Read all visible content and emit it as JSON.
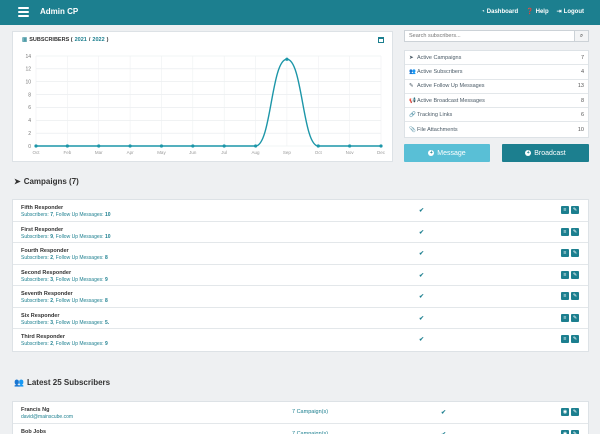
{
  "header": {
    "title": "Admin CP",
    "nav": [
      {
        "icon": "dashboard-icon",
        "label": "Dashboard"
      },
      {
        "icon": "help-icon",
        "label": "Help"
      },
      {
        "icon": "logout-icon",
        "label": "Logout"
      }
    ]
  },
  "chart_panel": {
    "title_prefix": "SUBSCRIBERS (",
    "year_a": "2021",
    "sep": " / ",
    "year_b": "2022",
    "title_suffix": ")"
  },
  "chart_data": {
    "type": "line",
    "title": "SUBSCRIBERS (2021 / 2022)",
    "categories": [
      "Oct",
      "Feb",
      "Mar",
      "Apr",
      "May",
      "Jun",
      "Jul",
      "Aug",
      "Sep",
      "Oct",
      "Nov",
      "Dec"
    ],
    "ylim": [
      0,
      14
    ],
    "yticks": [
      0,
      2,
      4,
      6,
      8,
      10,
      12,
      14
    ],
    "grid": true,
    "series": [
      {
        "values": [
          0,
          0,
          0,
          0,
          0,
          0,
          0,
          0,
          13.5,
          0,
          0,
          0
        ],
        "color": "#1c96a8"
      }
    ]
  },
  "search": {
    "placeholder": "Search subscribers..."
  },
  "stats": [
    {
      "icon": "send-icon",
      "label": "Active Campaigns",
      "value": "7"
    },
    {
      "icon": "users-icon",
      "label": "Active Subscribers",
      "value": "4"
    },
    {
      "icon": "edit-icon",
      "label": "Active Follow Up Messages",
      "value": "13"
    },
    {
      "icon": "megaphone-icon",
      "label": "Active Broadcast Messages",
      "value": "8"
    },
    {
      "icon": "link-icon",
      "label": "Tracking Links",
      "value": "6"
    },
    {
      "icon": "paperclip-icon",
      "label": "File Attachments",
      "value": "10"
    }
  ],
  "buttons": {
    "message": "Message",
    "broadcast": "Broadcast"
  },
  "campaigns": {
    "title": "Campaigns (7)",
    "subscribers_label": "Subscribers: ",
    "followup_label": ", Follow Up Messages: ",
    "items": [
      {
        "name": "Fifth Responder",
        "subscribers": "7",
        "followups": "10"
      },
      {
        "name": "First Responder",
        "subscribers": "9",
        "followups": "10"
      },
      {
        "name": "Fourth Responder",
        "subscribers": "2",
        "followups": "8"
      },
      {
        "name": "Second Responder",
        "subscribers": "3",
        "followups": "9"
      },
      {
        "name": "Seventh Responder",
        "subscribers": "2",
        "followups": "8"
      },
      {
        "name": "Six Responder",
        "subscribers": "3",
        "followups": "5."
      },
      {
        "name": "Third Responder",
        "subscribers": "2",
        "followups": "9"
      }
    ]
  },
  "subscribers": {
    "title": "Latest 25 Subscribers",
    "items": [
      {
        "name": "Francis Ng",
        "email": "david@mainscube.com",
        "campaigns": "7 Campaign(s)"
      },
      {
        "name": "Bob Jobs",
        "email": "",
        "campaigns": "7 Campaign(s)"
      }
    ]
  }
}
